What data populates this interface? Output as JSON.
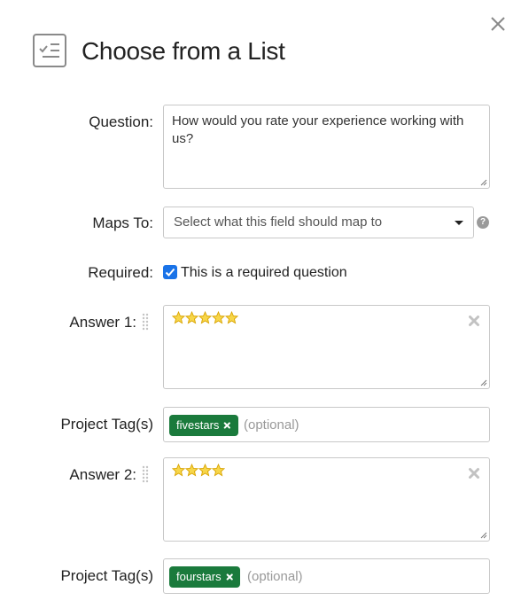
{
  "dialog": {
    "title": "Choose from a List",
    "close_icon": "close-icon",
    "title_icon": "list-check-icon"
  },
  "question": {
    "label": "Question:",
    "value": "How would you rate your experience working with us?"
  },
  "maps_to": {
    "label": "Maps To:",
    "placeholder": "Select what this field should map to",
    "help_glyph": "?"
  },
  "required": {
    "label": "Required:",
    "checkbox_label": "This is a required question",
    "checked": true
  },
  "answers": [
    {
      "label": "Answer 1:",
      "stars": 5,
      "tags_label": "Project Tag(s)",
      "tag": "fivestars",
      "tags_placeholder": "(optional)"
    },
    {
      "label": "Answer 2:",
      "stars": 4,
      "tags_label": "Project Tag(s)",
      "tag": "fourstars",
      "tags_placeholder": "(optional)"
    }
  ],
  "colors": {
    "tag_bg": "#1a7a3c",
    "checkbox": "#1a73e8",
    "star_fill": "#f7d64a",
    "star_stroke": "#d9a400"
  }
}
